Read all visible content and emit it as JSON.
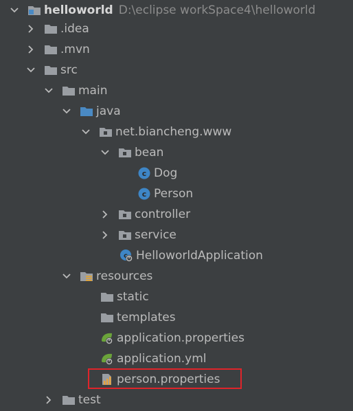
{
  "project": {
    "name": "helloworld",
    "path": "D:\\eclipse workSpace4\\helloworld"
  },
  "nodes": {
    "idea": ".idea",
    "mvn": ".mvn",
    "src": "src",
    "main": "main",
    "java": "java",
    "package": "net.biancheng.www",
    "bean": "bean",
    "dog": "Dog",
    "person": "Person",
    "controller": "controller",
    "service": "service",
    "app": "HelloworldApplication",
    "resources": "resources",
    "static": "static",
    "templates": "templates",
    "app_properties": "application.properties",
    "app_yml": "application.yml",
    "person_properties": "person.properties",
    "test": "test"
  },
  "colors": {
    "background": "#3c3f41",
    "text": "#bbbbbb",
    "folder": "#9a9ea3",
    "source_folder": "#4a8ac4",
    "class_icon": "#3e86c6",
    "spring_green": "#6ba43a",
    "highlight_border": "#e0242a"
  },
  "icons": {
    "expanded": "chevron-down-icon",
    "collapsed": "chevron-right-icon",
    "folder": "folder-icon",
    "module": "module-folder-icon",
    "source_root": "source-root-folder-icon",
    "resources_root": "resources-root-folder-icon",
    "package": "package-icon",
    "class": "class-icon",
    "spring_app": "spring-boot-app-icon",
    "spring_config": "spring-config-icon",
    "properties": "properties-file-icon"
  }
}
